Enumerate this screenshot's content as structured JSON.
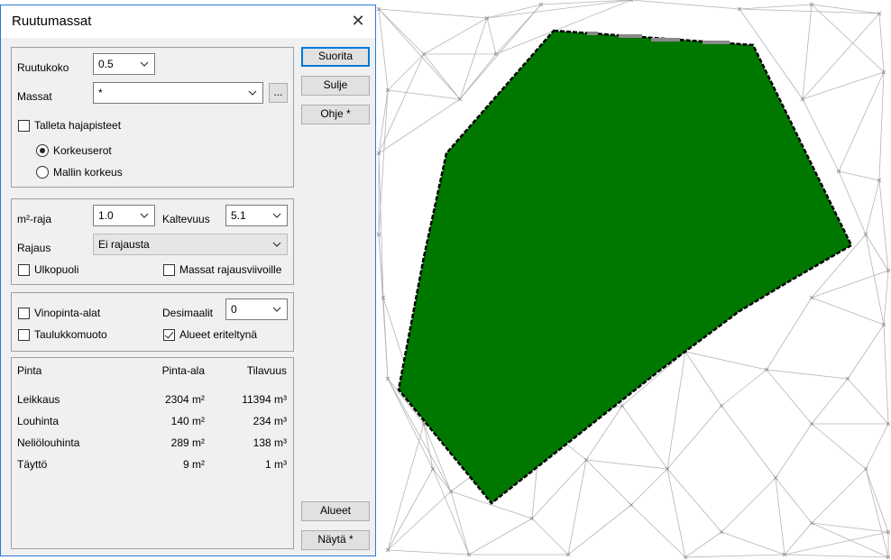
{
  "dialog": {
    "title": "Ruutumassat",
    "close_glyph": "✕",
    "ruutukoko": {
      "label": "Ruutukoko",
      "value": "0.5"
    },
    "massat": {
      "label": "Massat",
      "value": "*",
      "browse_label": "..."
    },
    "talleta": {
      "label": "Talleta hajapisteet",
      "checked": false
    },
    "radio": [
      {
        "label": "Korkeuserot",
        "checked": true
      },
      {
        "label": "Mallin korkeus",
        "checked": false
      }
    ],
    "m2raja": {
      "label": "m²-raja",
      "value": "1.0"
    },
    "kaltevuus": {
      "label": "Kaltevuus",
      "value": "5.1"
    },
    "rajaus": {
      "label": "Rajaus",
      "value": "Ei rajausta"
    },
    "ulkopuoli": {
      "label": "Ulkopuoli",
      "checked": false
    },
    "massat_rajaus": {
      "label": "Massat rajausviivoille",
      "checked": false
    },
    "vinopinta": {
      "label": "Vinopinta-alat",
      "checked": false
    },
    "desimaalit": {
      "label": "Desimaalit",
      "value": "0"
    },
    "taulukko": {
      "label": "Taulukkomuoto",
      "checked": false
    },
    "alueet_eriteltyna": {
      "label": "Alueet eriteltynä",
      "checked": true
    },
    "results": {
      "headers": [
        "Pinta",
        "Pinta-ala",
        "Tilavuus"
      ],
      "rows": [
        [
          "Leikkaus",
          "2304 m²",
          "11394 m³"
        ],
        [
          "Louhinta",
          "140 m²",
          "234 m³"
        ],
        [
          "Neliölouhinta",
          "289 m²",
          "138 m³"
        ],
        [
          "Täyttö",
          "9 m²",
          "1 m³"
        ]
      ]
    },
    "buttons": {
      "suorita": "Suorita",
      "sulje": "Sulje",
      "ohje": "Ohje *",
      "alueet": "Alueet",
      "nayta": "Näytä *"
    }
  },
  "colors": {
    "area_fill": "#007800",
    "accent": "#0078d7",
    "tin_lines": "#b4b4b4"
  }
}
